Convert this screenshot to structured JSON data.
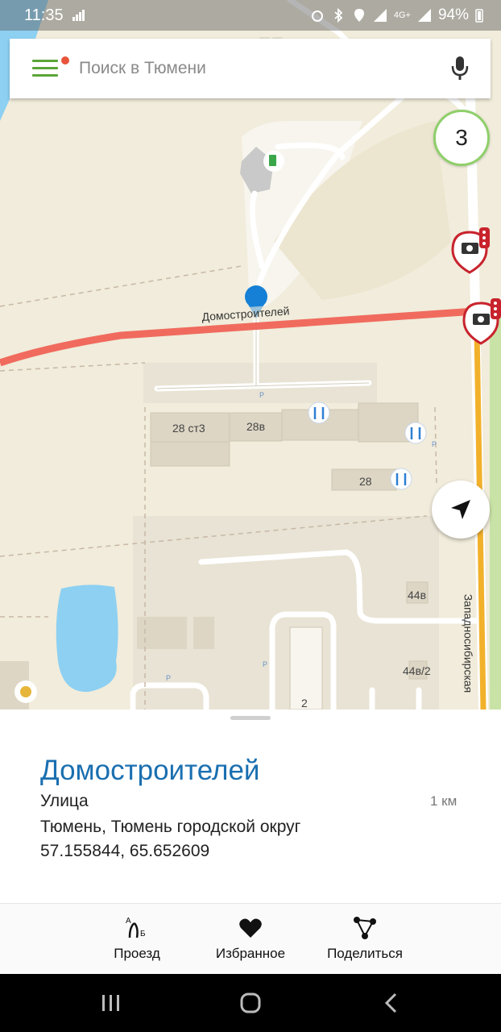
{
  "status_bar": {
    "time": "11:35",
    "network": "4G+",
    "battery": "94%"
  },
  "search": {
    "placeholder": "Поиск в Тюмени"
  },
  "map": {
    "street_label": "Домостроителей",
    "side_street_label": "Западносибирская",
    "counter": "3",
    "buildings": [
      "28 ст3",
      "28в",
      "28",
      "44в",
      "44в/2",
      "2"
    ],
    "parking_label": "P"
  },
  "place": {
    "title": "Домостроителей",
    "type": "Улица",
    "distance": "1 км",
    "address": "Тюмень, Тюмень городской округ",
    "coordinates": "57.155844, 65.652609"
  },
  "actions": [
    {
      "label": "Проезд",
      "icon": "route-icon"
    },
    {
      "label": "Избранное",
      "icon": "heart-icon"
    },
    {
      "label": "Поделиться",
      "icon": "share-icon"
    }
  ],
  "colors": {
    "accent": "#1a6fb0",
    "menu": "#5aa537",
    "road": "#f06b5e",
    "highway": "#f2b12b"
  }
}
